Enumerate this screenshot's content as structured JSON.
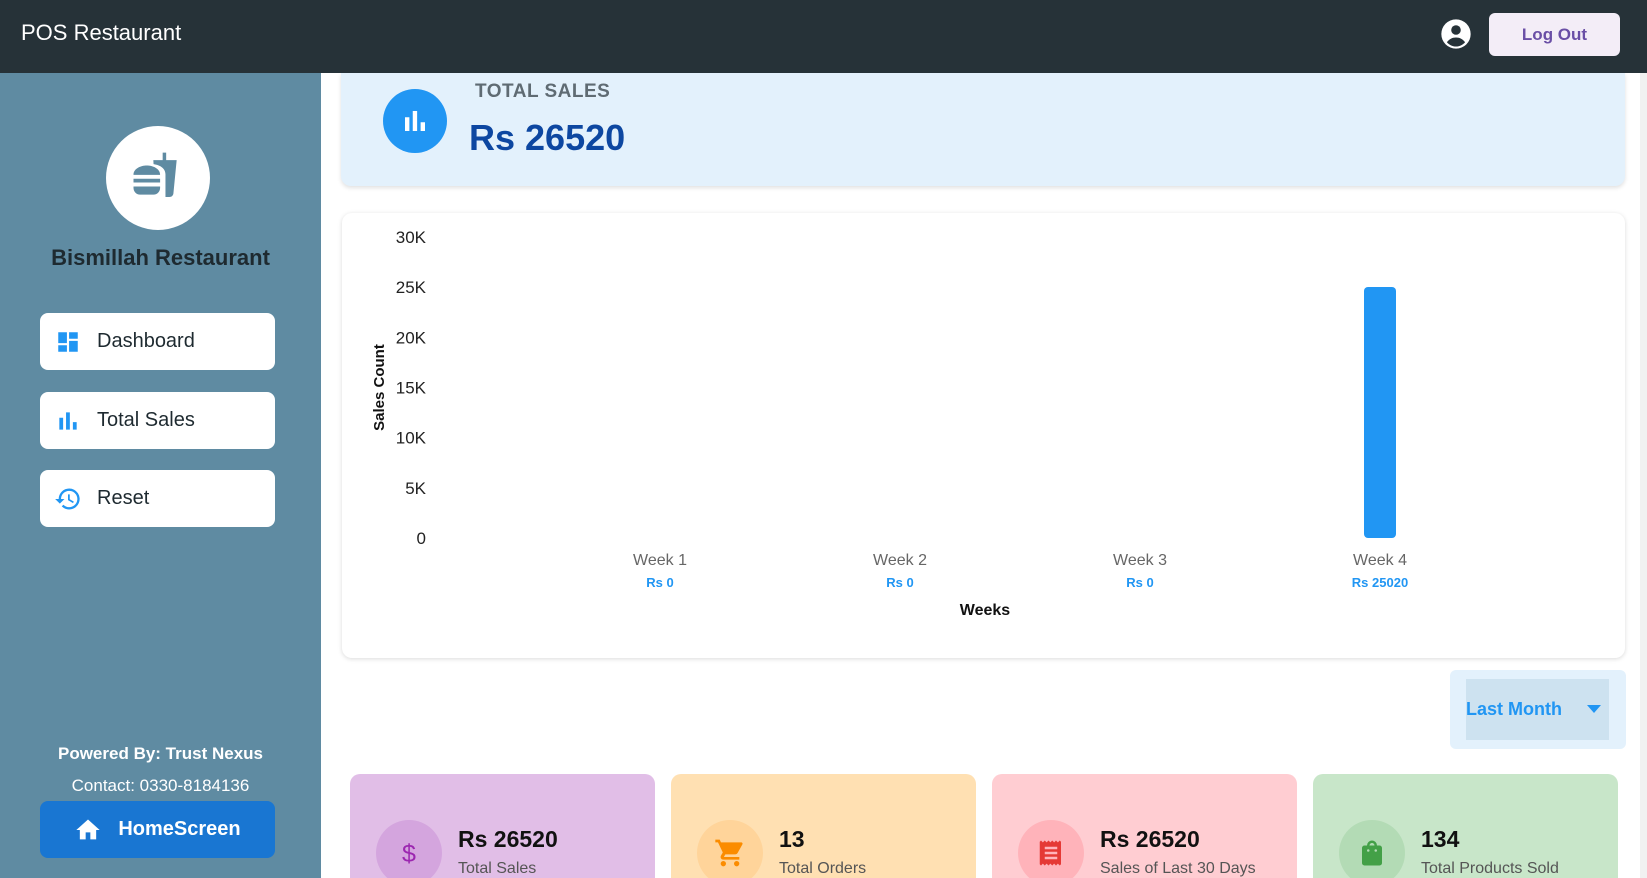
{
  "header": {
    "app_title": "POS Restaurant",
    "account_icon": "account-circle-icon",
    "logout_label": "Log Out"
  },
  "sidebar": {
    "logo_icon": "fastfood-icon",
    "restaurant_name": "Bismillah Restaurant",
    "items": [
      {
        "label": "Dashboard",
        "icon": "dashboard-icon"
      },
      {
        "label": "Total Sales",
        "icon": "bar-chart-icon"
      },
      {
        "label": "Reset",
        "icon": "restore-icon"
      }
    ],
    "powered_by": "Powered By: Trust Nexus",
    "contact": "Contact: 0330-8184136",
    "home_label": "HomeScreen",
    "home_icon": "home-icon"
  },
  "total_sales": {
    "label": "TOTAL SALES",
    "value": "Rs 26520",
    "icon": "bar-chart-icon"
  },
  "chart_data": {
    "type": "bar",
    "categories": [
      "Week 1",
      "Week 2",
      "Week 3",
      "Week 4"
    ],
    "values": [
      0,
      0,
      0,
      25020
    ],
    "value_labels": [
      "Rs 0",
      "Rs 0",
      "Rs 0",
      "Rs 25020"
    ],
    "xlabel": "Weeks",
    "ylabel": "Sales Count",
    "ylim": [
      0,
      30000
    ],
    "yticks": [
      "0",
      "5K",
      "10K",
      "15K",
      "20K",
      "25K",
      "30K"
    ],
    "grid": false,
    "bar_color": "#2196f3"
  },
  "period_select": {
    "value": "Last Month"
  },
  "stats": [
    {
      "value": "Rs 26520",
      "label": "Total Sales",
      "icon": "dollar-icon",
      "bg": "#e1bee7",
      "icon_bg": "#d4a5de",
      "icon_color": "#9c27b0"
    },
    {
      "value": "13",
      "label": "Total Orders",
      "icon": "cart-icon",
      "bg": "#ffe0b2",
      "icon_bg": "#ffd49a",
      "icon_color": "#fb8c00"
    },
    {
      "value": "Rs 26520",
      "label": "Sales of Last 30 Days",
      "icon": "receipt-icon",
      "bg": "#ffcdd2",
      "icon_bg": "#ffb3ba",
      "icon_color": "#e53935"
    },
    {
      "value": "134",
      "label": "Total Products Sold",
      "icon": "shopping-bag-icon",
      "bg": "#c8e6c9",
      "icon_bg": "#b3dbb5",
      "icon_color": "#43a047"
    }
  ]
}
